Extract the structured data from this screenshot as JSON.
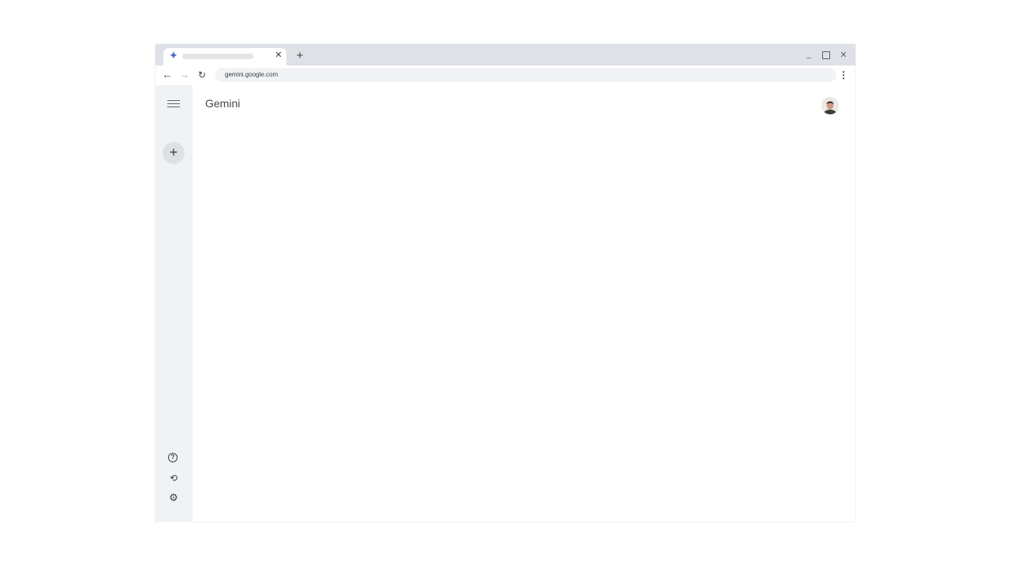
{
  "browser": {
    "tab": {
      "favicon": "gemini-sparkle-icon",
      "close_glyph": "✕"
    },
    "new_tab_glyph": "+",
    "window_controls": {
      "minimize": "_",
      "close": "✕"
    },
    "toolbar": {
      "back_glyph": "←",
      "forward_glyph": "→",
      "reload_glyph": "↻",
      "url": "gemini.google.com",
      "bookmark_glyph": "☆",
      "menu_glyph": "⋮"
    }
  },
  "sidebar": {
    "menu_icon": "hamburger-icon",
    "new_chat_glyph": "+",
    "help_glyph": "?",
    "history_glyph": "⟲",
    "settings_glyph": "⚙"
  },
  "main": {
    "title": "Gemini",
    "avatar_icon": "user-avatar"
  },
  "colors": {
    "tabstrip": "#dee1e6",
    "sidebar": "#f0f2f6",
    "accent": "#4c6cc9"
  }
}
